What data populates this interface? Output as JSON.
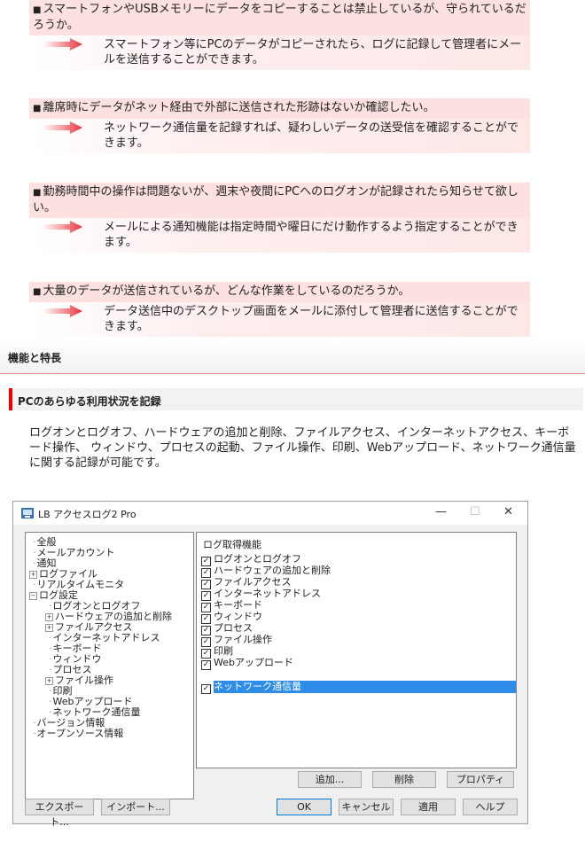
{
  "faq": [
    {
      "question": "スマートフォンやUSBメモリーにデータをコピーすることは禁止しているが、守られているだろうか。",
      "answer": "スマートフォン等にPCのデータがコピーされたら、ログに記録して管理者にメールを送信することができます。"
    },
    {
      "question": "離席時にデータがネット経由で外部に送信された形跡はないか確認したい。",
      "answer": "ネットワーク通信量を記録すれば、疑わしいデータの送受信を確認することができます。"
    },
    {
      "question": "勤務時間中の操作は問題ないが、週末や夜間にPCへのログオンが記録されたら知らせて欲しい。",
      "answer": "メールによる通知機能は指定時間や曜日にだけ動作するよう指定することができます。"
    },
    {
      "question": "大量のデータが送信されているが、どんな作業をしているのだろうか。",
      "answer": "データ送信中のデスクトップ画面をメールに添付して管理者に送信することができます。"
    }
  ],
  "section_title": "機能と特長",
  "subsection_title": "PCのあらゆる利用状況を記録",
  "description": "ログオンとログオフ、ハードウェアの追加と削除、ファイルアクセス、インターネットアクセス、キーボード操作、 ウィンドウ、プロセスの起動、ファイル操作、印刷、Webアップロード、ネットワーク通信量に関する記録が可能です。",
  "window": {
    "title": "LB アクセスログ2 Pro",
    "minimize": "—",
    "maximize": "☐",
    "close": "✕",
    "tree": [
      {
        "label": "全般",
        "level": 0,
        "expander": false
      },
      {
        "label": "メールアカウント",
        "level": 0,
        "expander": false
      },
      {
        "label": "通知",
        "level": 0,
        "expander": false
      },
      {
        "label": "ログファイル",
        "level": 0,
        "expander": true
      },
      {
        "label": "リアルタイムモニタ",
        "level": 0,
        "expander": false
      },
      {
        "label": "ログ設定",
        "level": 0,
        "expander": true,
        "expanded": true
      },
      {
        "label": "ログオンとログオフ",
        "level": 1,
        "expander": false
      },
      {
        "label": "ハードウェアの追加と削除",
        "level": 1,
        "expander": true
      },
      {
        "label": "ファイルアクセス",
        "level": 1,
        "expander": true
      },
      {
        "label": "インターネットアドレス",
        "level": 1,
        "expander": false
      },
      {
        "label": "キーボード",
        "level": 1,
        "expander": false
      },
      {
        "label": "ウィンドウ",
        "level": 1,
        "expander": false
      },
      {
        "label": "プロセス",
        "level": 1,
        "expander": false
      },
      {
        "label": "ファイル操作",
        "level": 1,
        "expander": true
      },
      {
        "label": "印刷",
        "level": 1,
        "expander": false
      },
      {
        "label": "Webアップロード",
        "level": 1,
        "expander": false
      },
      {
        "label": "ネットワーク通信量",
        "level": 1,
        "expander": false
      },
      {
        "label": "バージョン情報",
        "level": 0,
        "expander": false
      },
      {
        "label": "オープンソース情報",
        "level": 0,
        "expander": false
      }
    ],
    "panel_title": "ログ取得機能",
    "log_items": [
      {
        "label": "ログオンとログオフ",
        "checked": true,
        "selected": false
      },
      {
        "label": "ハードウェアの追加と削除",
        "checked": true,
        "selected": false
      },
      {
        "label": "ファイルアクセス",
        "checked": true,
        "selected": false
      },
      {
        "label": "インターネットアドレス",
        "checked": true,
        "selected": false
      },
      {
        "label": "キーボード",
        "checked": true,
        "selected": false
      },
      {
        "label": "ウィンドウ",
        "checked": true,
        "selected": false
      },
      {
        "label": "プロセス",
        "checked": true,
        "selected": false
      },
      {
        "label": "ファイル操作",
        "checked": true,
        "selected": false
      },
      {
        "label": "印刷",
        "checked": true,
        "selected": false
      },
      {
        "label": "Webアップロード",
        "checked": true,
        "selected": false
      },
      {
        "label": "ネットワーク通信量",
        "checked": true,
        "selected": true
      }
    ],
    "buttons": {
      "add": "追加...",
      "delete": "削除",
      "properties": "プロパティ",
      "export": "エクスポート...",
      "import": "インポート...",
      "ok": "OK",
      "cancel": "キャンセル",
      "apply": "適用",
      "help": "ヘルプ"
    }
  },
  "colors": {
    "question_bg": "#fde1e1",
    "arrow": "#e8323c",
    "accent_bar": "#ee0000",
    "selection": "#2d8ce8"
  }
}
